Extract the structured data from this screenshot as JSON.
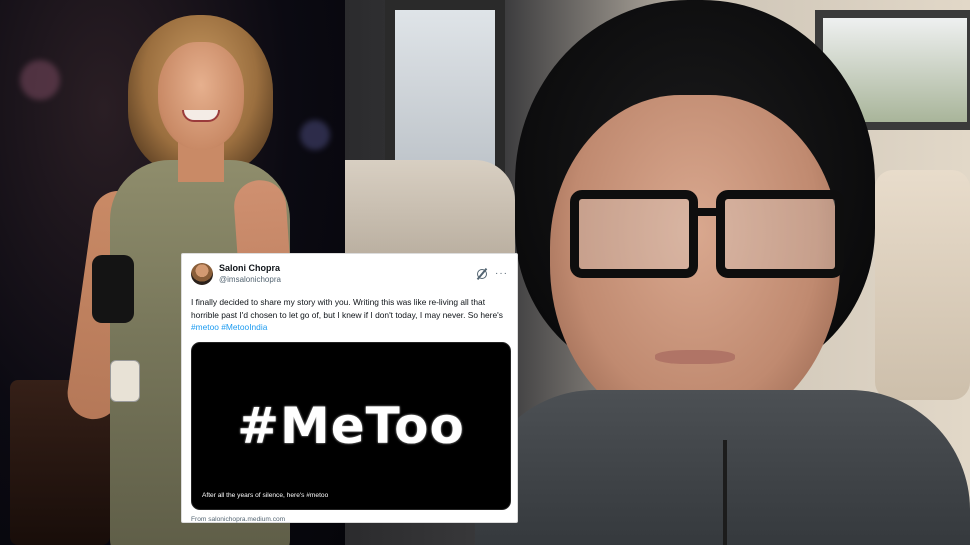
{
  "tweet": {
    "display_name": "Saloni Chopra",
    "handle": "@imsalonichopra",
    "text_before": "I finally decided to share my story with you. Writing this was like re-living all that horrible past I'd chosen to let go of, but I knew if I don't today, I may never. So here's ",
    "hashtag_1": "#metoo",
    "hashtag_2": "#MetooIndia",
    "media_title": "#MeToo",
    "media_caption": "After all the years of silence, here's #metoo",
    "source": "From salonichopra.medium.com",
    "link_color": "#1d9bf0"
  }
}
